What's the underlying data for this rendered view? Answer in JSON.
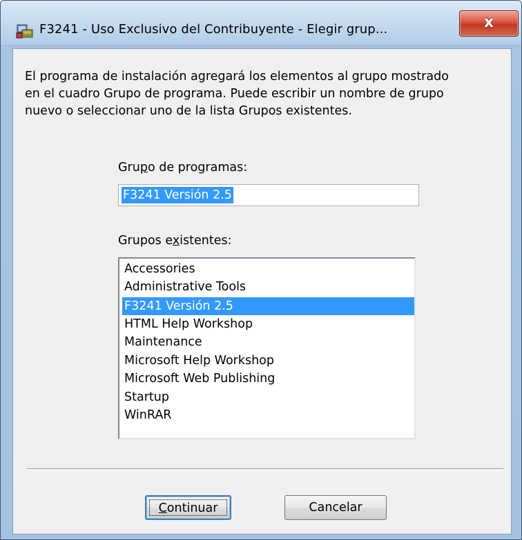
{
  "window": {
    "title": "F3241 - Uso Exclusivo del Contribuyente - Elegir grup...",
    "close_label": "x"
  },
  "intro_text": "El programa de instalación agregará los elementos al grupo mostrado\nen el cuadro Grupo de programa. Puede escribir un nombre de grupo\nnuevo o seleccionar uno de la lista Grupos existentes.",
  "program_group": {
    "label_pre": "Gru",
    "label_mnemonic": "p",
    "label_post": "o de programas:",
    "value": "F3241 Versión 2.5"
  },
  "existing_groups": {
    "label_pre": "Grupos e",
    "label_mnemonic": "x",
    "label_post": "istentes:",
    "items": [
      "Accessories",
      "Administrative Tools",
      "F3241 Versión 2.5",
      "HTML Help Workshop",
      "Maintenance",
      "Microsoft Help Workshop",
      "Microsoft Web Publishing",
      "Startup",
      "WinRAR"
    ],
    "selected_index": 2
  },
  "buttons": {
    "continue_mnemonic": "C",
    "continue_rest": "ontinuar",
    "cancel": "Cancelar"
  },
  "colors": {
    "selection": "#3399ff",
    "dialog_bg": "#f0f0f0",
    "close_button": "#c23a22"
  }
}
